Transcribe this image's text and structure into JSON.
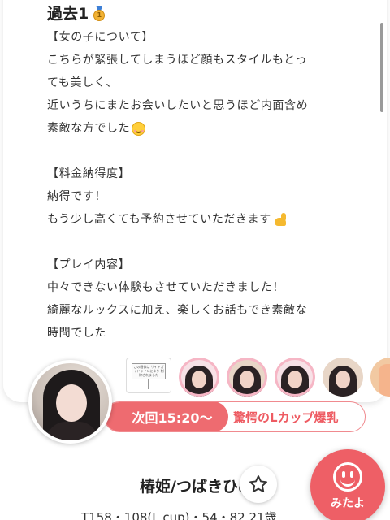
{
  "review": {
    "title": "過去1",
    "medal_icon": "gold-medal-icon",
    "lines": [
      "【女の子について】",
      "こちらが緊張してしまうほど顔もスタイルもとっ",
      "ても美しく、",
      "近いうちにまたお会いしたいと思うほど内面含め",
      "素敵な方でした",
      "",
      "【料金納得度】",
      "納得です！",
      "もう少し高くても予約させていただきます",
      "",
      "【プレイ内容】",
      "中々できない体験もさせていただきました！",
      "綺麗なルックスに加え、楽しくお話もでき素敵な",
      "時間でした"
    ]
  },
  "thumbnails": {
    "notice_text": "この画像は サイトガイドラインにより 削除されました",
    "items": [
      "photo-thumbnail",
      "photo-thumbnail",
      "photo-thumbnail",
      "photo-thumbnail",
      "photo-thumbnail"
    ]
  },
  "schedule": {
    "next_label": "次回15:20〜",
    "catchphrase": "驚愕のLカップ爆乳"
  },
  "profile": {
    "name": "椿姫/つばきひめ",
    "stats": "T158・108(L cup)・54・82  21歳"
  },
  "actions": {
    "mitayo_label": "みたよ"
  },
  "colors": {
    "accent": "#ee6b70",
    "catchphrase": "#ee5b62"
  }
}
